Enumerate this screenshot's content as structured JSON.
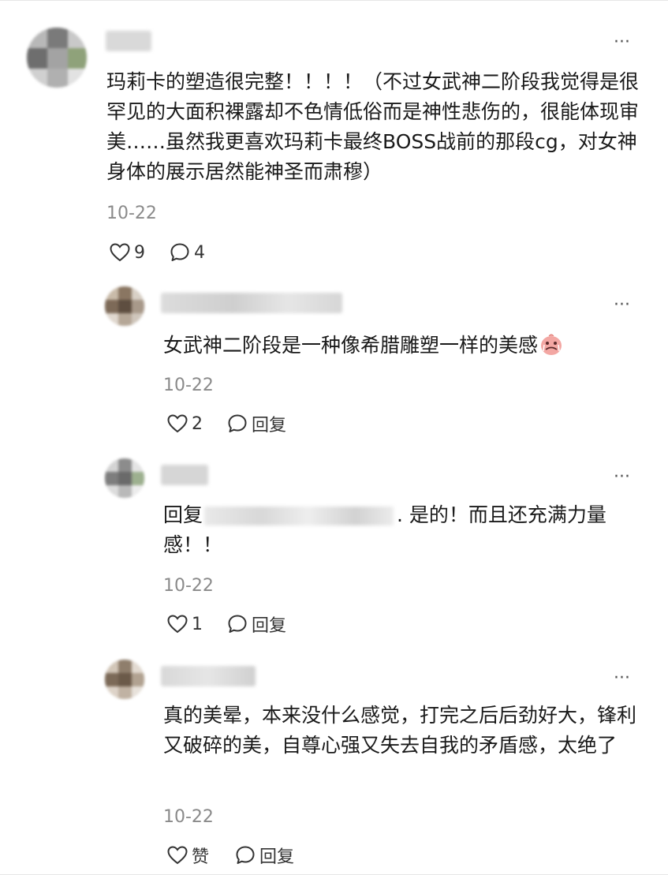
{
  "comments": [
    {
      "text": "玛莉卡的塑造很完整！！！！（不过女武神二阶段我觉得是很罕见的大面积裸露却不色情低俗而是神性悲伤的，很能体现审美……虽然我更喜欢玛莉卡最终BOSS战前的那段cg，对女神身体的展示居然能神圣而肃穆）",
      "date": "10-22",
      "like_count": "9",
      "reply_count": "4"
    },
    {
      "text": "女武神二阶段是一种像希腊雕塑一样的美感",
      "date": "10-22",
      "like_count": "2",
      "reply_label": "回复"
    },
    {
      "reply_prefix": "回复",
      "text": ". 是的！而且还充满力量感！！",
      "date": "10-22",
      "like_count": "1",
      "reply_label": "回复"
    },
    {
      "text": "真的美晕，本来没什么感觉，打完之后后劲好大，锋利又破碎的美，自尊心强又失去自我的矛盾感，太绝了",
      "date": "10-22",
      "like_label": "赞",
      "reply_label": "回复"
    }
  ],
  "icons": {
    "more": "more-dots-icon",
    "like": "heart-outline-icon",
    "reply": "speech-bubble-icon",
    "emoji": "crying-face-emoji"
  },
  "colors": {
    "text": "#1a1a1a",
    "muted": "#8a8a8a",
    "icon": "#333333"
  }
}
